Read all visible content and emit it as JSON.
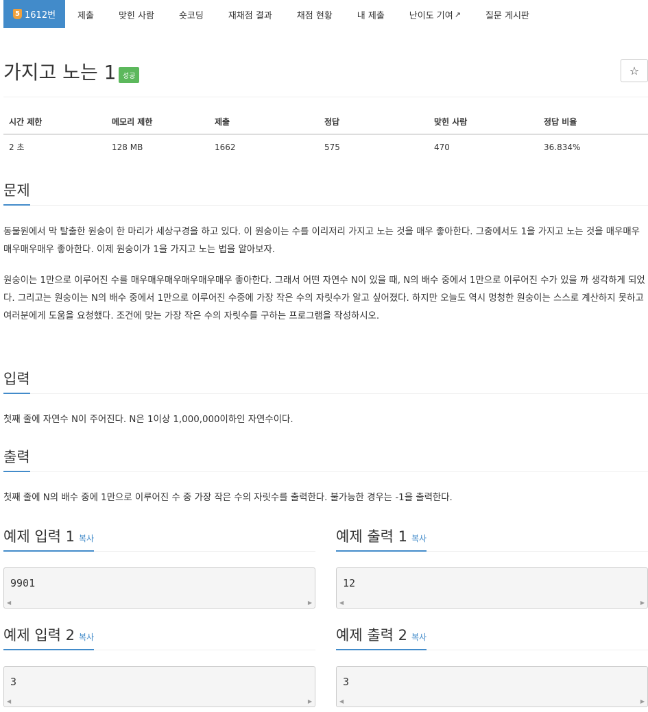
{
  "nav": {
    "problem_number": "1612번",
    "items": [
      "제출",
      "맞힌 사람",
      "숏코딩",
      "재채점 결과",
      "채점 현황",
      "내 제출",
      "난이도 기여",
      "질문 게시판"
    ]
  },
  "title": "가지고 노는 1",
  "status": "성공",
  "star": "☆",
  "info": {
    "headers": [
      "시간 제한",
      "메모리 제한",
      "제출",
      "정답",
      "맞힌 사람",
      "정답 비율"
    ],
    "values": [
      "2 초",
      "128 MB",
      "1662",
      "575",
      "470",
      "36.834%"
    ]
  },
  "sections": {
    "problem": {
      "heading": "문제",
      "p1": "동물원에서 막 탈출한 원숭이 한 마리가 세상구경을 하고 있다. 이 원숭이는 수를 이리저리 가지고 노는 것을 매우 좋아한다. 그중에서도 1을 가지고 노는 것을 매우매우매우매우매우 좋아한다. 이제 원숭이가 1을 가지고 노는 법을 알아보자.",
      "p2": "원숭이는 1만으로 이루어진 수를 매우매우매우매우매우매우 좋아한다. 그래서 어떤 자연수 N이 있을 때, N의 배수 중에서 1만으로 이루어진 수가 있을 까 생각하게 되었다. 그리고는 원숭이는 N의 배수 중에서 1만으로 이루어진 수중에 가장 작은 수의 자릿수가 알고 싶어졌다. 하지만 오늘도 역시 멍청한 원숭이는 스스로 계산하지 못하고 여러분에게 도움을 요청했다. 조건에 맞는 가장 작은 수의 자릿수를 구하는 프로그램을 작성하시오."
    },
    "input": {
      "heading": "입력",
      "text": "첫째 줄에 자연수 N이 주어진다. N은 1이상 1,000,000이하인 자연수이다."
    },
    "output": {
      "heading": "출력",
      "text": "첫째 줄에 N의 배수 중에 1만으로 이루어진 수 중 가장 작은 수의 자릿수를 출력한다. 불가능한 경우는 -1을 출력한다."
    }
  },
  "examples": [
    {
      "in_heading": "예제 입력 1",
      "out_heading": "예제 출력 1",
      "copy": "복사",
      "input": "9901",
      "output": "12"
    },
    {
      "in_heading": "예제 입력 2",
      "out_heading": "예제 출력 2",
      "copy": "복사",
      "input": "3",
      "output": "3"
    }
  ],
  "scroll": {
    "left": "◀",
    "right": "▶"
  }
}
